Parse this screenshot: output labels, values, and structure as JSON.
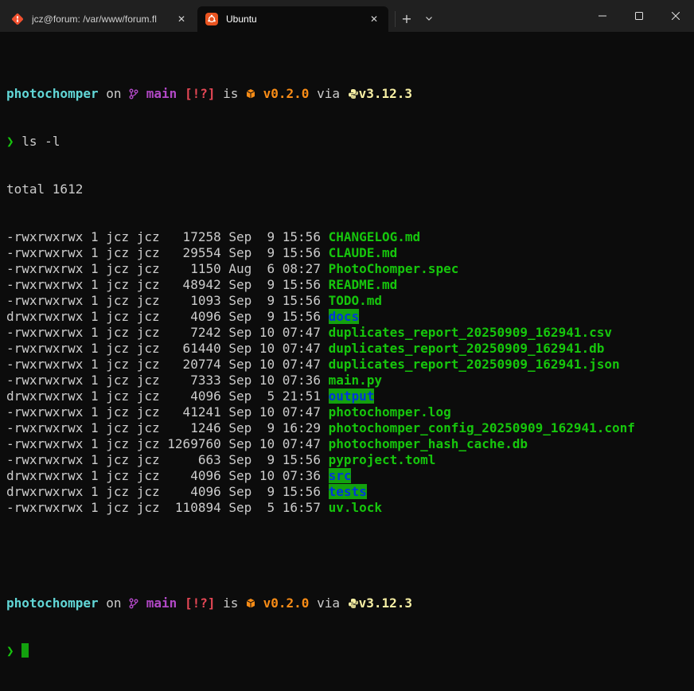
{
  "tabs": [
    {
      "title": "jcz@forum: /var/www/forum.fl",
      "icon": "git-icon",
      "active": false
    },
    {
      "title": "Ubuntu",
      "icon": "ubuntu-icon",
      "active": true
    }
  ],
  "tab_controls": {
    "new_tab": "+",
    "dropdown": "chevron-down-icon"
  },
  "window_controls": [
    "minimize-icon",
    "maximize-icon",
    "close-icon"
  ],
  "prompt": {
    "dir": "photochomper",
    "on": " on ",
    "branch_icon": "git-branch-icon",
    "branch": "main",
    "status": "[!?]",
    "is": " is ",
    "package_icon": "package-icon",
    "version": "v0.2.0",
    "via": " via ",
    "python_icon": "python-icon",
    "python_version": "v3.12.3",
    "arrow": "❯"
  },
  "command": "ls -l",
  "total_line": "total 1612",
  "listing": [
    {
      "meta": "-rwxrwxrwx 1 jcz jcz   17258 Sep  9 15:56 ",
      "name": "CHANGELOG.md",
      "is_dir": false
    },
    {
      "meta": "-rwxrwxrwx 1 jcz jcz   29554 Sep  9 15:56 ",
      "name": "CLAUDE.md",
      "is_dir": false
    },
    {
      "meta": "-rwxrwxrwx 1 jcz jcz    1150 Aug  6 08:27 ",
      "name": "PhotoChomper.spec",
      "is_dir": false
    },
    {
      "meta": "-rwxrwxrwx 1 jcz jcz   48942 Sep  9 15:56 ",
      "name": "README.md",
      "is_dir": false
    },
    {
      "meta": "-rwxrwxrwx 1 jcz jcz    1093 Sep  9 15:56 ",
      "name": "TODO.md",
      "is_dir": false
    },
    {
      "meta": "drwxrwxrwx 1 jcz jcz    4096 Sep  9 15:56 ",
      "name": "docs",
      "is_dir": true
    },
    {
      "meta": "-rwxrwxrwx 1 jcz jcz    7242 Sep 10 07:47 ",
      "name": "duplicates_report_20250909_162941.csv",
      "is_dir": false
    },
    {
      "meta": "-rwxrwxrwx 1 jcz jcz   61440 Sep 10 07:47 ",
      "name": "duplicates_report_20250909_162941.db",
      "is_dir": false
    },
    {
      "meta": "-rwxrwxrwx 1 jcz jcz   20774 Sep 10 07:47 ",
      "name": "duplicates_report_20250909_162941.json",
      "is_dir": false
    },
    {
      "meta": "-rwxrwxrwx 1 jcz jcz    7333 Sep 10 07:36 ",
      "name": "main.py",
      "is_dir": false
    },
    {
      "meta": "drwxrwxrwx 1 jcz jcz    4096 Sep  5 21:51 ",
      "name": "output",
      "is_dir": true
    },
    {
      "meta": "-rwxrwxrwx 1 jcz jcz   41241 Sep 10 07:47 ",
      "name": "photochomper.log",
      "is_dir": false
    },
    {
      "meta": "-rwxrwxrwx 1 jcz jcz    1246 Sep  9 16:29 ",
      "name": "photochomper_config_20250909_162941.conf",
      "is_dir": false
    },
    {
      "meta": "-rwxrwxrwx 1 jcz jcz 1269760 Sep 10 07:47 ",
      "name": "photochomper_hash_cache.db",
      "is_dir": false
    },
    {
      "meta": "-rwxrwxrwx 1 jcz jcz     663 Sep  9 15:56 ",
      "name": "pyproject.toml",
      "is_dir": false
    },
    {
      "meta": "drwxrwxrwx 1 jcz jcz    4096 Sep 10 07:36 ",
      "name": "src",
      "is_dir": true
    },
    {
      "meta": "drwxrwxrwx 1 jcz jcz    4096 Sep  9 15:56 ",
      "name": "tests",
      "is_dir": true
    },
    {
      "meta": "-rwxrwxrwx 1 jcz jcz  110894 Sep  5 16:57 ",
      "name": "uv.lock",
      "is_dir": false
    }
  ]
}
